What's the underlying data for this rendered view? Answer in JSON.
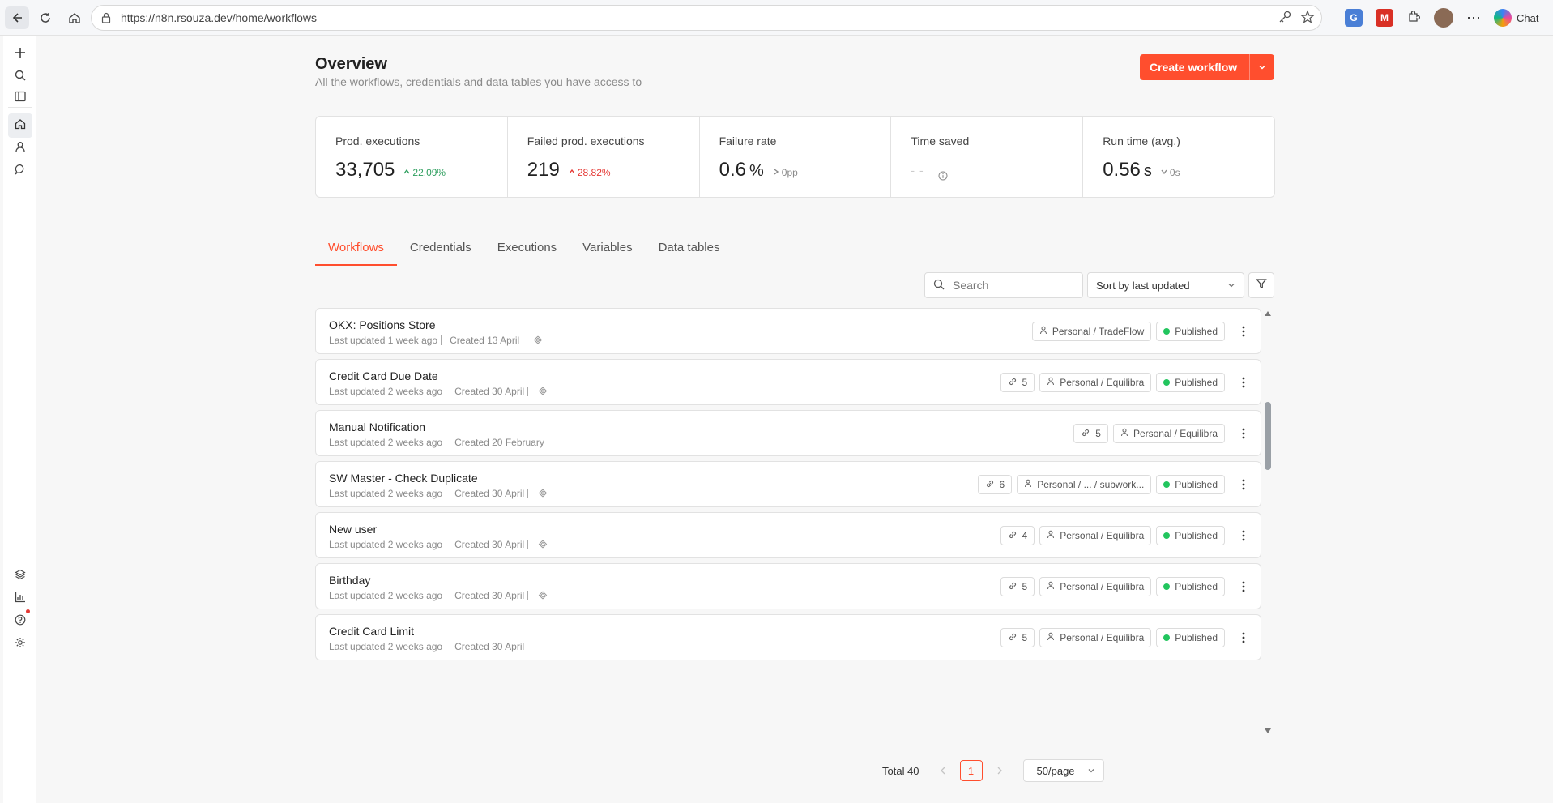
{
  "browser": {
    "url": "https://n8n.rsouza.dev/home/workflows",
    "chat_label": "Chat"
  },
  "header": {
    "title": "Overview",
    "subtitle": "All the workflows, credentials and data tables you have access to",
    "create_label": "Create workflow"
  },
  "stats": [
    {
      "label": "Prod. executions",
      "value": "33,705",
      "unit": "",
      "delta": "22.09%",
      "delta_dir": "up",
      "delta_tone": "good"
    },
    {
      "label": "Failed prod. executions",
      "value": "219",
      "unit": "",
      "delta": "28.82%",
      "delta_dir": "up",
      "delta_tone": "bad"
    },
    {
      "label": "Failure rate",
      "value": "0.6",
      "unit": "%",
      "delta": "0pp",
      "delta_dir": "right",
      "delta_tone": "neutral"
    },
    {
      "label": "Time saved",
      "value": "",
      "unit": "",
      "delta": "",
      "delta_dir": "",
      "delta_tone": "neutral",
      "placeholder": "- -"
    },
    {
      "label": "Run time (avg.)",
      "value": "0.56",
      "unit": "s",
      "delta": "0s",
      "delta_dir": "down",
      "delta_tone": "neutral"
    }
  ],
  "tabs": [
    {
      "label": "Workflows",
      "active": true
    },
    {
      "label": "Credentials",
      "active": false
    },
    {
      "label": "Executions",
      "active": false
    },
    {
      "label": "Variables",
      "active": false
    },
    {
      "label": "Data tables",
      "active": false
    }
  ],
  "toolbar": {
    "search_placeholder": "Search",
    "sort_value": "Sort by last updated"
  },
  "workflows": [
    {
      "title": "OKX: Positions Store",
      "updated": "Last updated 1 week ago",
      "created": "Created 13 April",
      "mcp": true,
      "links": "",
      "project": "Personal / TradeFlow",
      "status": "Published"
    },
    {
      "title": "Credit Card Due Date",
      "updated": "Last updated 2 weeks ago",
      "created": "Created 30 April",
      "mcp": true,
      "links": "5",
      "project": "Personal / Equilibra",
      "status": "Published"
    },
    {
      "title": "Manual Notification",
      "updated": "Last updated 2 weeks ago",
      "created": "Created 20 February",
      "mcp": false,
      "links": "5",
      "project": "Personal / Equilibra",
      "status": ""
    },
    {
      "title": "SW Master - Check Duplicate",
      "updated": "Last updated 2 weeks ago",
      "created": "Created 30 April",
      "mcp": true,
      "links": "6",
      "project": "Personal / ... / subwork...",
      "status": "Published"
    },
    {
      "title": "New user",
      "updated": "Last updated 2 weeks ago",
      "created": "Created 30 April",
      "mcp": true,
      "links": "4",
      "project": "Personal / Equilibra",
      "status": "Published"
    },
    {
      "title": "Birthday",
      "updated": "Last updated 2 weeks ago",
      "created": "Created 30 April",
      "mcp": true,
      "links": "5",
      "project": "Personal / Equilibra",
      "status": "Published"
    },
    {
      "title": "Credit Card Limit",
      "updated": "Last updated 2 weeks ago",
      "created": "Created 30 April",
      "mcp": false,
      "links": "5",
      "project": "Personal / Equilibra",
      "status": "Published"
    }
  ],
  "pagination": {
    "total": "Total 40",
    "current_page": "1",
    "page_size": "50/page"
  },
  "colors": {
    "accent": "#ff4e2e",
    "published": "#22c55e",
    "delta_good": "#2e9e5e",
    "delta_bad": "#e53935"
  }
}
